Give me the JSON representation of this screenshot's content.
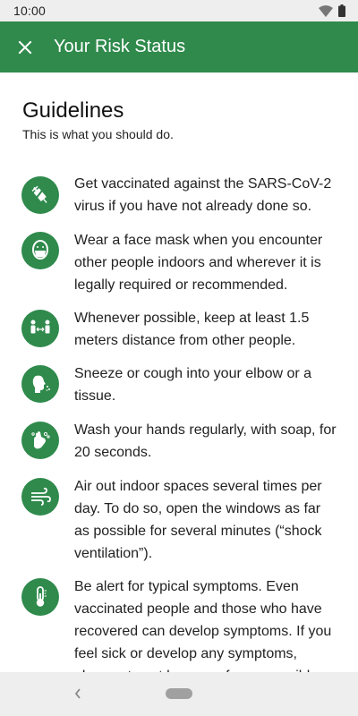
{
  "status_bar": {
    "time": "10:00"
  },
  "app_bar": {
    "title": "Your Risk Status",
    "close_icon": "close-icon",
    "background": "#2f8a4c"
  },
  "main": {
    "heading": "Guidelines",
    "subheading": "This is what you should do.",
    "guidelines": [
      {
        "icon": "vaccine-icon",
        "text": "Get vaccinated against the SARS-CoV-2 virus if you have not already done so."
      },
      {
        "icon": "face-mask-icon",
        "text": "Wear a face mask when you encounter other people indoors and wherever it is legally required or recommended."
      },
      {
        "icon": "distance-icon",
        "text": "Whenever possible, keep at least 1.5 meters distance from other people."
      },
      {
        "icon": "sneeze-icon",
        "text": "Sneeze or cough into your elbow or a tissue."
      },
      {
        "icon": "hand-wash-icon",
        "text": "Wash your hands regularly, with soap, for 20 seconds."
      },
      {
        "icon": "ventilation-icon",
        "text": "Air out indoor spaces several times per day. To do so, open the windows as far as possible for several minutes (“shock ventilation”)."
      },
      {
        "icon": "thermometer-icon",
        "text": "Be alert for typical symptoms. Even vaccinated people and those who have recovered can develop symptoms. If you feel sick or develop any symptoms, please stay at home as far as possible."
      }
    ]
  },
  "nav_bar": {
    "back_icon": "back-icon",
    "home_icon": "home-pill-icon"
  }
}
